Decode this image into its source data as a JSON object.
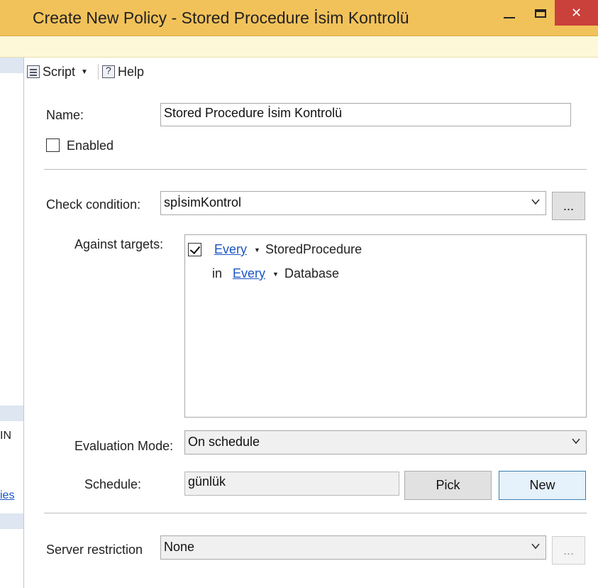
{
  "window": {
    "title": "Create New Policy - Stored Procedure İsim Kontrolü",
    "close_glyph": "✕"
  },
  "left_pane": {
    "text_fragment": "IN",
    "link_fragment": "ies"
  },
  "toolbar": {
    "script_label": "Script",
    "help_label": "Help"
  },
  "form": {
    "name_label": "Name:",
    "name_value": "Stored Procedure İsim Kontrolü",
    "enabled_label": "Enabled",
    "enabled_checked": false,
    "check_condition_label": "Check condition:",
    "check_condition_value": "spİsimKontrol",
    "browse_label": "...",
    "against_targets_label": "Against targets:",
    "targets": {
      "row1": {
        "checked": true,
        "quantifier": "Every",
        "object": "StoredProcedure"
      },
      "row2": {
        "prefix": "in",
        "quantifier": "Every",
        "object": "Database"
      }
    },
    "evaluation_mode_label": "Evaluation Mode:",
    "evaluation_mode_value": "On schedule",
    "schedule_label": "Schedule:",
    "schedule_value": "günlük",
    "pick_label": "Pick",
    "new_label": "New",
    "server_restriction_label": "Server restriction",
    "server_restriction_value": "None",
    "server_browse_label": "..."
  },
  "colors": {
    "titlebar": "#f2c25a",
    "infobar": "#fdf8d8",
    "close_button": "#c9413a",
    "link": "#1a55c4"
  }
}
